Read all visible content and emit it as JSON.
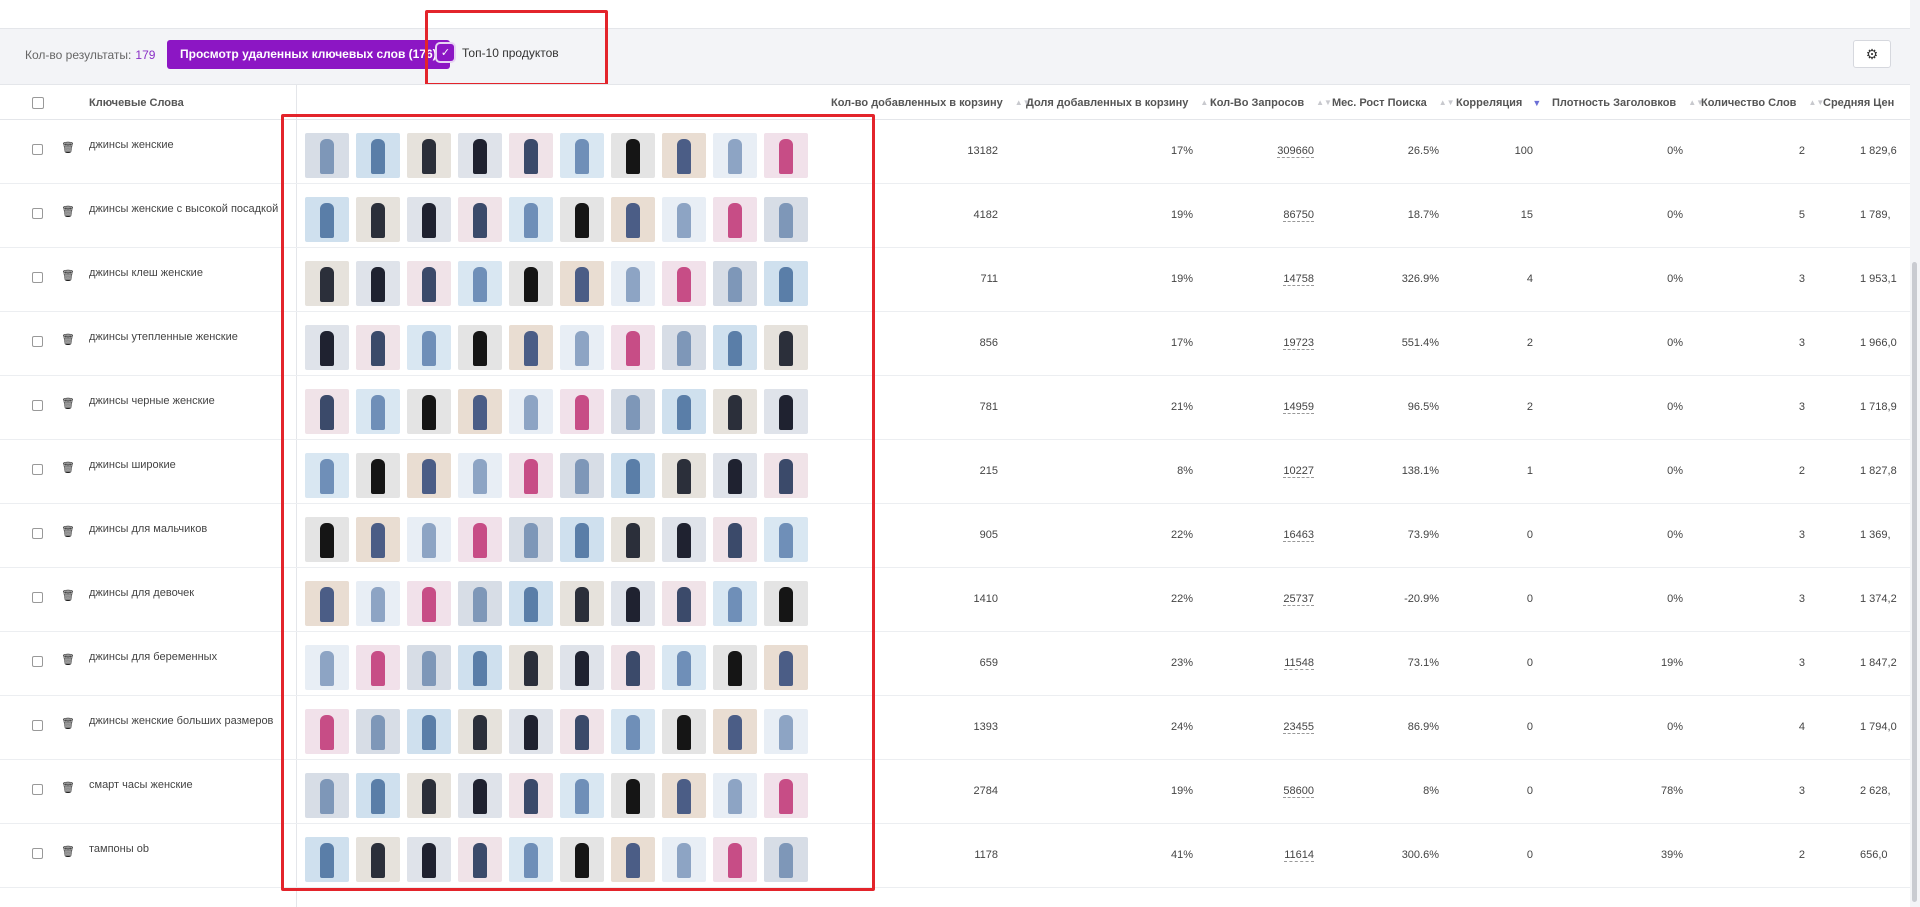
{
  "toolbar": {
    "results_label": "Кол-во результаты:",
    "results_count": "179",
    "deleted_button": "Просмотр удаленных ключевых слов (176)",
    "top10_label": "Топ-10 продуктов",
    "top10_checked": true,
    "settings_icon": "gear-icon"
  },
  "colors": {
    "accent": "#8c16c4",
    "highlight": "#e3242b"
  },
  "table": {
    "columns": [
      "Ключевые Слова",
      "Кол-во добавленных в корзину",
      "Доля добавленных в корзину",
      "Кол-Во Запросов",
      "Мес. Рост Поиска",
      "Корреляция",
      "Плотность Заголовков",
      "Количество Слов",
      "Средняя Цен"
    ],
    "sorted_column": "Корреляция",
    "rows": [
      {
        "keyword": "джинсы женские",
        "cart": "13182",
        "share": "17%",
        "queries": "309660",
        "growth": "26.5%",
        "corr": "100",
        "density": "0%",
        "words": "2",
        "price": "1 829,6"
      },
      {
        "keyword": "джинсы женские с высокой посадкой",
        "cart": "4182",
        "share": "19%",
        "queries": "86750",
        "growth": "18.7%",
        "corr": "15",
        "density": "0%",
        "words": "5",
        "price": "1 789,"
      },
      {
        "keyword": "джинсы клеш женские",
        "cart": "711",
        "share": "19%",
        "queries": "14758",
        "growth": "326.9%",
        "corr": "4",
        "density": "0%",
        "words": "3",
        "price": "1 953,1"
      },
      {
        "keyword": "джинсы утепленные женские",
        "cart": "856",
        "share": "17%",
        "queries": "19723",
        "growth": "551.4%",
        "corr": "2",
        "density": "0%",
        "words": "3",
        "price": "1 966,0"
      },
      {
        "keyword": "джинсы черные женские",
        "cart": "781",
        "share": "21%",
        "queries": "14959",
        "growth": "96.5%",
        "corr": "2",
        "density": "0%",
        "words": "3",
        "price": "1 718,9"
      },
      {
        "keyword": "джинсы широкие",
        "cart": "215",
        "share": "8%",
        "queries": "10227",
        "growth": "138.1%",
        "corr": "1",
        "density": "0%",
        "words": "2",
        "price": "1 827,8"
      },
      {
        "keyword": "джинсы для мальчиков",
        "cart": "905",
        "share": "22%",
        "queries": "16463",
        "growth": "73.9%",
        "corr": "0",
        "density": "0%",
        "words": "3",
        "price": "1 369,"
      },
      {
        "keyword": "джинсы для девочек",
        "cart": "1410",
        "share": "22%",
        "queries": "25737",
        "growth": "-20.9%",
        "corr": "0",
        "density": "0%",
        "words": "3",
        "price": "1 374,2"
      },
      {
        "keyword": "джинсы для беременных",
        "cart": "659",
        "share": "23%",
        "queries": "11548",
        "growth": "73.1%",
        "corr": "0",
        "density": "19%",
        "words": "3",
        "price": "1 847,2"
      },
      {
        "keyword": "джинсы женские больших размеров",
        "cart": "1393",
        "share": "24%",
        "queries": "23455",
        "growth": "86.9%",
        "corr": "0",
        "density": "0%",
        "words": "4",
        "price": "1 794,0"
      },
      {
        "keyword": "смарт часы женские",
        "cart": "2784",
        "share": "19%",
        "queries": "58600",
        "growth": "8%",
        "corr": "0",
        "density": "78%",
        "words": "3",
        "price": "2 628,"
      },
      {
        "keyword": "тампоны ob",
        "cart": "1178",
        "share": "41%",
        "queries": "11614",
        "growth": "300.6%",
        "corr": "0",
        "density": "39%",
        "words": "2",
        "price": "656,0"
      }
    ]
  }
}
